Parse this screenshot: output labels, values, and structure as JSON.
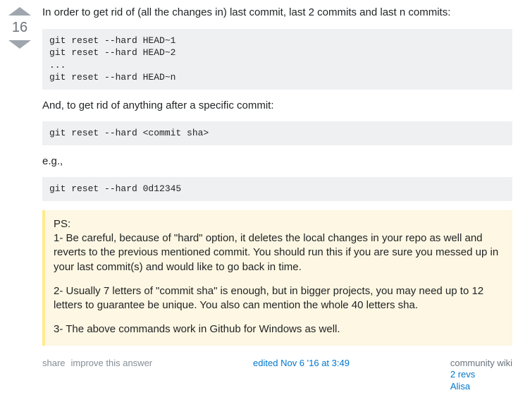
{
  "vote": {
    "score": "16"
  },
  "body": {
    "p1": "In order to get rid of (all the changes in) last commit, last 2 commits and last n commits:",
    "code1": "git reset --hard HEAD~1\ngit reset --hard HEAD~2\n...\ngit reset --hard HEAD~n",
    "p2": "And, to get rid of anything after a specific commit:",
    "code2": "git reset --hard <commit sha>",
    "p3": "e.g.,",
    "code3": "git reset --hard 0d12345",
    "note": {
      "ps": "PS:",
      "n1": "1- Be careful, because of \"hard\" option, it deletes the local changes in your repo as well and reverts to the previous mentioned commit. You should run this if you are sure you messed up in your last commit(s) and would like to go back in time.",
      "n2": "2- Usually 7 letters of \"commit sha\" is enough, but in bigger projects, you may need up to 12 letters to guarantee be unique. You also can mention the whole 40 letters sha.",
      "n3": "3- The above commands work in Github for Windows as well."
    }
  },
  "menu": {
    "share": "share",
    "improve": "improve this answer",
    "edited": "edited Nov 6 '16 at 3:49",
    "cw": "community wiki",
    "revs": "2 revs",
    "author": "Alisa"
  }
}
